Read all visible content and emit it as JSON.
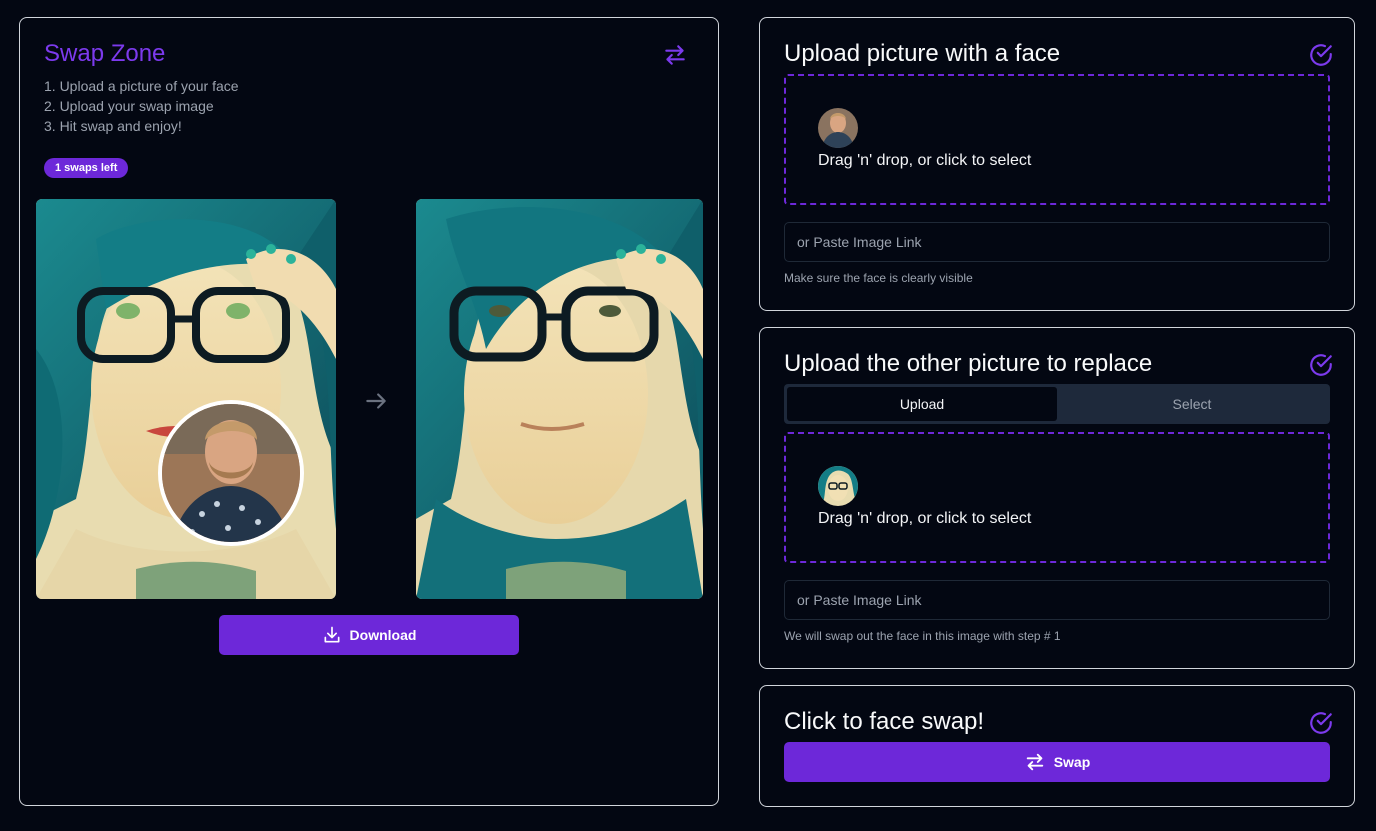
{
  "colors": {
    "accent": "#6d28d9",
    "title_accent": "#7c3aed",
    "background": "#030712",
    "muted": "#9ca3af"
  },
  "left_panel": {
    "title": "Swap Zone",
    "title_icon": "swap-arrows-icon",
    "steps": [
      "1. Upload a picture of your face",
      "2. Upload your swap image",
      "3. Hit swap and enjoy!"
    ],
    "badge": "1 swaps left",
    "arrow_icon": "arrow-right-icon",
    "download_label": "Download",
    "download_icon": "download-icon"
  },
  "face_card": {
    "title": "Upload picture with a face",
    "check_icon": "check-circle-icon",
    "dropzone_text": "Drag 'n' drop, or click to select",
    "link_placeholder": "or Paste Image Link",
    "hint": "Make sure the face is clearly visible"
  },
  "replace_card": {
    "title": "Upload the other picture to replace",
    "check_icon": "check-circle-icon",
    "tabs": [
      {
        "label": "Upload",
        "active": true
      },
      {
        "label": "Select",
        "active": false
      }
    ],
    "dropzone_text": "Drag 'n' drop, or click to select",
    "link_placeholder": "or Paste Image Link",
    "hint": "We will swap out the face in this image with step # 1"
  },
  "swap_card": {
    "title": "Click to face swap!",
    "check_icon": "check-circle-icon",
    "swap_label": "Swap",
    "swap_icon": "swap-arrows-icon"
  }
}
